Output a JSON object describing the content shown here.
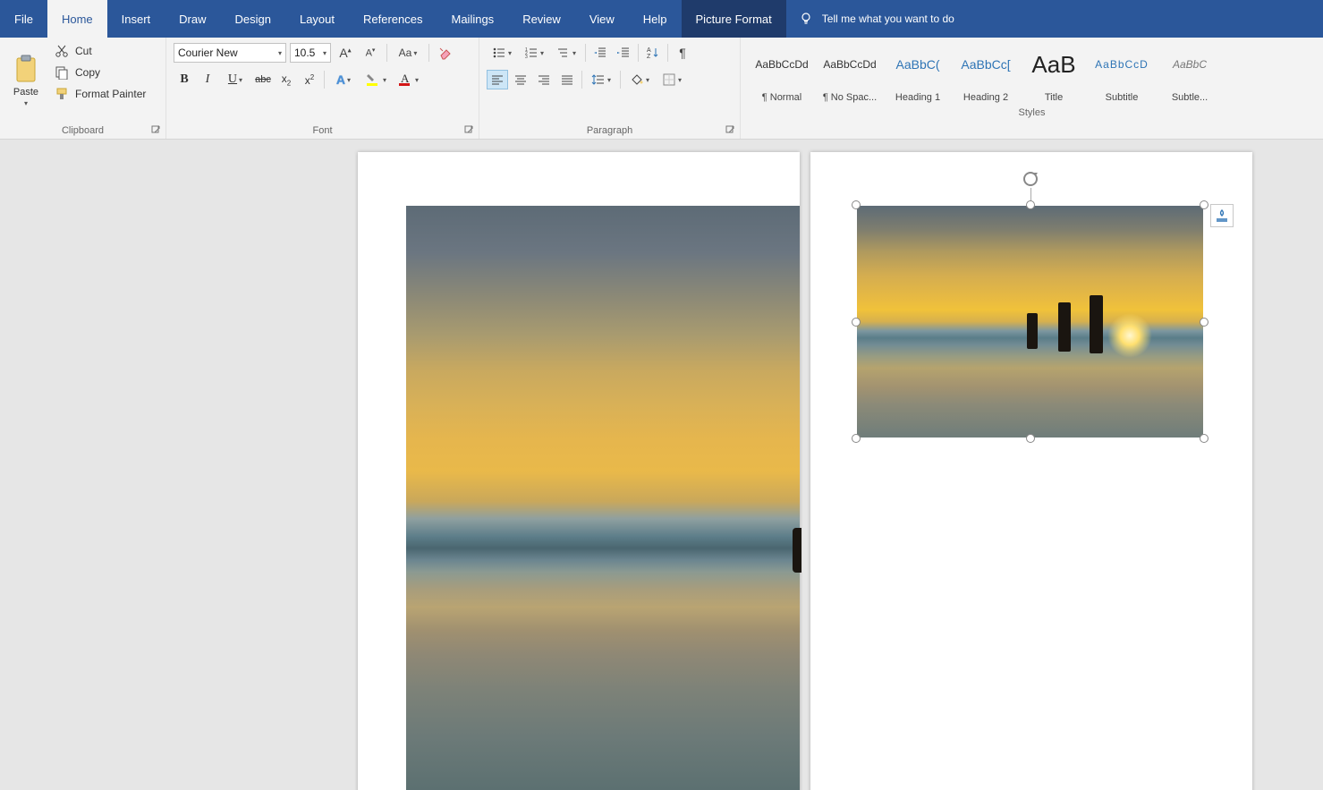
{
  "tabs": {
    "file": "File",
    "home": "Home",
    "insert": "Insert",
    "draw": "Draw",
    "design": "Design",
    "layout": "Layout",
    "references": "References",
    "mailings": "Mailings",
    "review": "Review",
    "view": "View",
    "help": "Help",
    "picture_format": "Picture Format"
  },
  "tellme": {
    "placeholder": "Tell me what you want to do"
  },
  "clipboard": {
    "paste": "Paste",
    "cut": "Cut",
    "copy": "Copy",
    "format_painter": "Format Painter",
    "group_label": "Clipboard"
  },
  "font": {
    "name": "Courier New",
    "size": "10.5",
    "group_label": "Font"
  },
  "paragraph": {
    "group_label": "Paragraph"
  },
  "styles": {
    "group_label": "Styles",
    "items": [
      {
        "preview": "AaBbCcDd",
        "name": "¶ Normal",
        "cls": ""
      },
      {
        "preview": "AaBbCcDd",
        "name": "¶ No Spac...",
        "cls": ""
      },
      {
        "preview": "AaBbC(",
        "name": "Heading 1",
        "cls": "heading"
      },
      {
        "preview": "AaBbCc[",
        "name": "Heading 2",
        "cls": "heading"
      },
      {
        "preview": "AaB",
        "name": "Title",
        "cls": "big"
      },
      {
        "preview": "AaBbCcD",
        "name": "Subtitle",
        "cls": "sub"
      },
      {
        "preview": "AaBbC",
        "name": "Subtle...",
        "cls": "sub2"
      }
    ]
  },
  "icons": {
    "bold": "B",
    "italic": "I",
    "underline": "U",
    "strike": "abc"
  },
  "colors": {
    "ribbon_blue": "#2b579a",
    "highlight_yellow": "#ffff00",
    "font_red": "#d31616",
    "heading_blue": "#2e74b5"
  }
}
